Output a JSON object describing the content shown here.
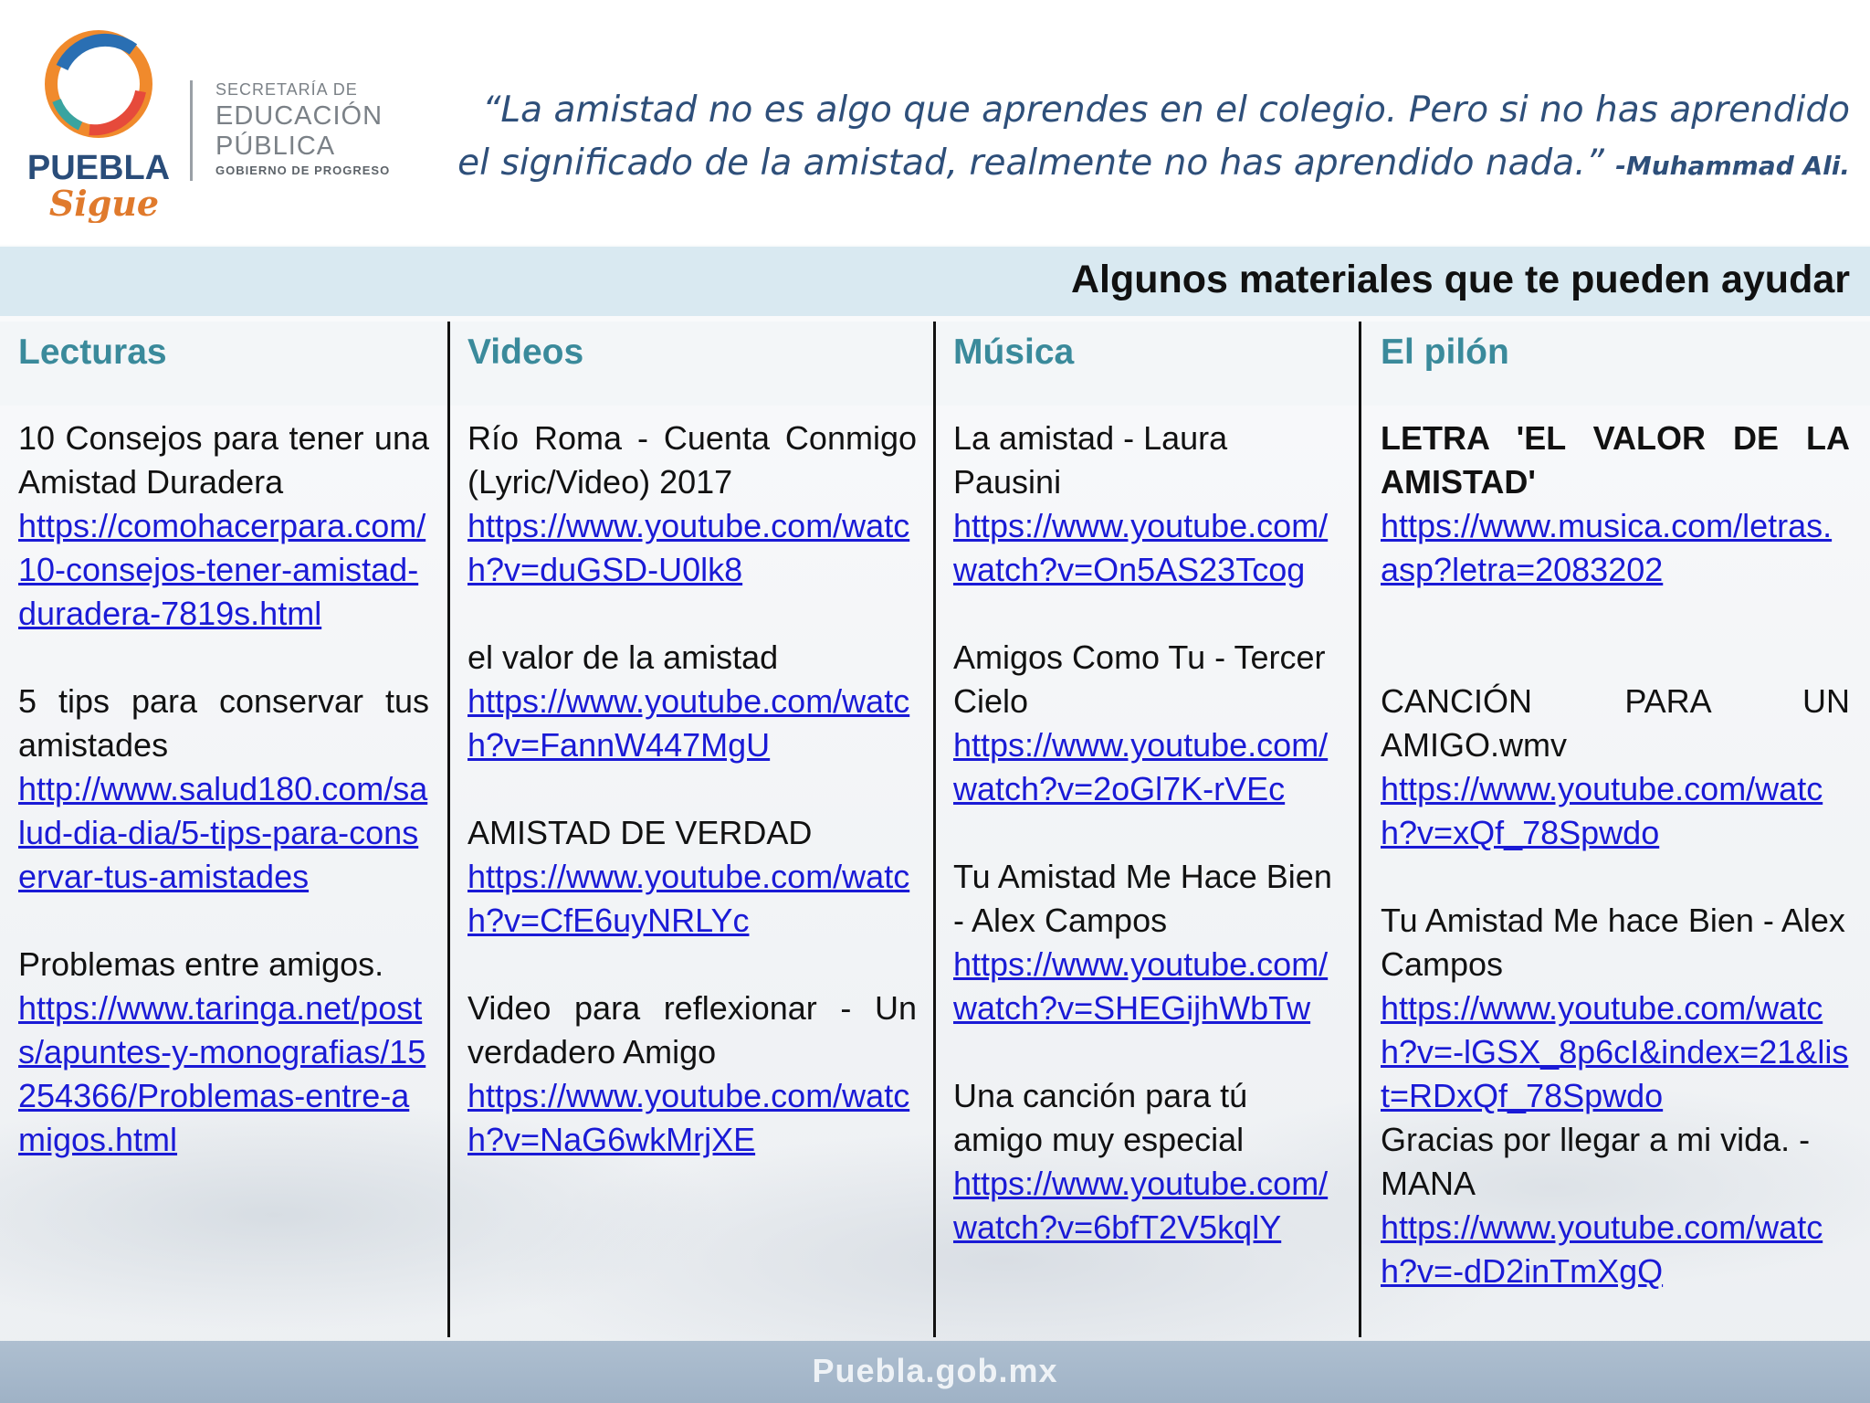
{
  "header": {
    "logo": {
      "line1": "PUEBLA",
      "line2": "Sigue"
    },
    "secretaria": {
      "line1": "SECRETARÍA DE",
      "line2": "EDUCACIÓN PÚBLICA",
      "line3": "GOBIERNO DE PROGRESO"
    },
    "quote_line1": "“La amistad no es algo que aprendes en el colegio. Pero si no has aprendido",
    "quote_line2": "el significado de la amistad, realmente no has aprendido nada.”",
    "quote_author": "-Muhammad Ali."
  },
  "banner": {
    "title": "Algunos materiales que te pueden ayudar"
  },
  "columns": [
    {
      "heading": "Lecturas"
    },
    {
      "heading": "Videos"
    },
    {
      "heading": "Música"
    },
    {
      "heading": "El pilón"
    }
  ],
  "lecturas": [
    {
      "text": "10 Consejos para tener una Amistad Duradera",
      "link": "https://comohacerpara.com/10-consejos-tener-amistad-duradera-7819s.html"
    },
    {
      "text": "5 tips para conservar tus amistades",
      "link": "http://www.salud180.com/salud-dia-dia/5-tips-para-conservar-tus-amistades"
    },
    {
      "text": "Problemas entre amigos.",
      "link": "https://www.taringa.net/posts/apuntes-y-monografias/15254366/Problemas-entre-amigos.html"
    }
  ],
  "videos": [
    {
      "text": "Río Roma - Cuenta Conmigo (Lyric/Video) 2017",
      "link": "https://www.youtube.com/watch?v=duGSD-U0lk8"
    },
    {
      "text": "el valor de la amistad",
      "link": "https://www.youtube.com/watch?v=FannW447MgU"
    },
    {
      "text": "AMISTAD DE VERDAD",
      "link": "https://www.youtube.com/watch?v=CfE6uyNRLYc"
    },
    {
      "text": "Video para reflexionar - Un verdadero Amigo",
      "link": "https://www.youtube.com/watch?v=NaG6wkMrjXE"
    }
  ],
  "musica": [
    {
      "text": "La amistad - Laura Pausini",
      "link": "https://www.youtube.com/watch?v=On5AS23Tcog"
    },
    {
      "text": "Amigos Como Tu - Tercer Cielo",
      "link": "https://www.youtube.com/watch?v=2oGl7K-rVEc"
    },
    {
      "text": "Tu Amistad Me Hace Bien - Alex Campos",
      "link": "https://www.youtube.com/watch?v=SHEGijhWbTw"
    },
    {
      "text": "Una canción para tú amigo muy especial",
      "link": "https://www.youtube.com/watch?v=6bfT2V5kqlY"
    }
  ],
  "pilon": [
    {
      "text": "LETRA 'EL VALOR DE LA AMISTAD'",
      "link": "https://www.musica.com/letras.asp?letra=2083202"
    },
    {
      "text": "CANCIÓN PARA UN AMIGO.wmv",
      "link": "https://www.youtube.com/watch?v=xQf_78Spwdo"
    },
    {
      "text": "Tu Amistad Me hace Bien - Alex Campos",
      "link": "https://www.youtube.com/watch?v=-lGSX_8p6cI&index=21&list=RDxQf_78Spwdo"
    },
    {
      "text": "Gracias por llegar a mi vida. - MANA",
      "link": "https://www.youtube.com/watch?v=-dD2inTmXgQ"
    }
  ],
  "footer": {
    "text": "Puebla.gob.mx"
  },
  "colors": {
    "heading": "#3a8a9b",
    "link": "#1a1ad6",
    "quote": "#2e4f7a",
    "banner": "#d9e9f1"
  }
}
